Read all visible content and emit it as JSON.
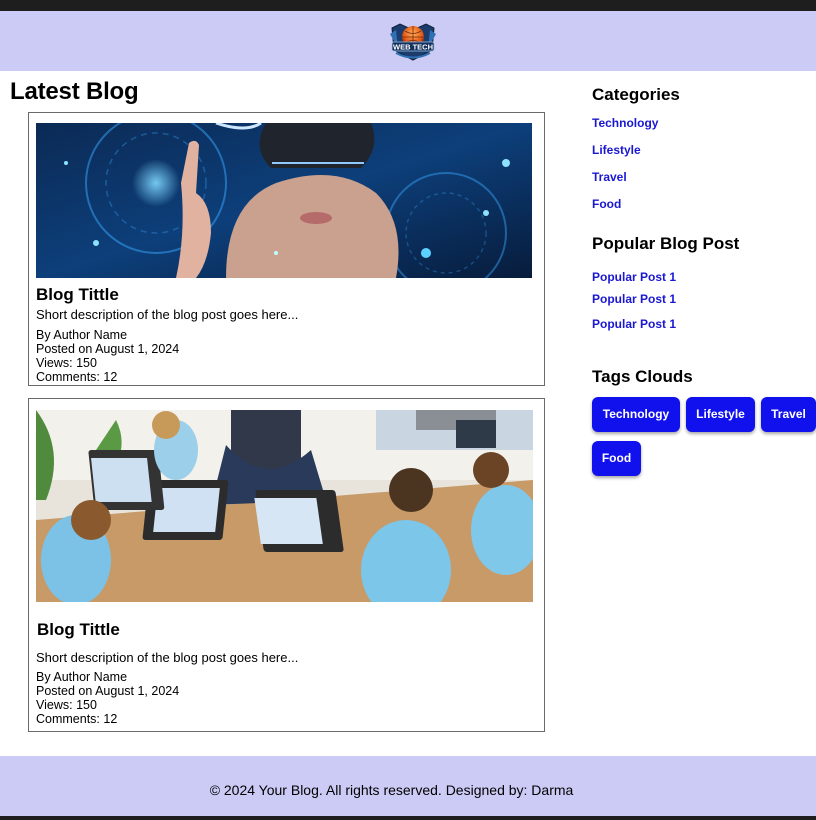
{
  "header": {
    "logo_text": "WEB TECH",
    "logo_icon": "globe-logo-icon"
  },
  "main": {
    "title": "Latest Blog",
    "posts": [
      {
        "image": "vr-headset-woman-photo",
        "title": "Blog Tittle",
        "description": "Short description of the blog post goes here...",
        "author": "By Author Name",
        "posted": "Posted on August 1, 2024",
        "views": "Views: 150",
        "comments": "Comments: 12"
      },
      {
        "image": "kids-laptops-classroom-photo",
        "title": "Blog Tittle",
        "description": "Short description of the blog post goes here...",
        "author": "By Author Name",
        "posted": "Posted on August 1, 2024",
        "views": "Views: 150",
        "comments": "Comments: 12"
      }
    ]
  },
  "sidebar": {
    "categories_title": "Categories",
    "categories": [
      "Technology",
      "Lifestyle",
      "Travel",
      "Food"
    ],
    "popular_title": "Popular Blog Post",
    "popular": [
      "Popular Post 1",
      "Popular Post 1",
      "Popular Post 1"
    ],
    "tags_title": "Tags Clouds",
    "tags": [
      "Technology",
      "Lifestyle",
      "Travel",
      "Food"
    ]
  },
  "footer": {
    "text": "© 2024 Your Blog. All rights reserved. Designed by: Darma"
  },
  "colors": {
    "header_bg": "#cccbf6",
    "link": "#1a17d1",
    "tag_bg": "#1111ee",
    "topbar": "#1e1e1e"
  }
}
